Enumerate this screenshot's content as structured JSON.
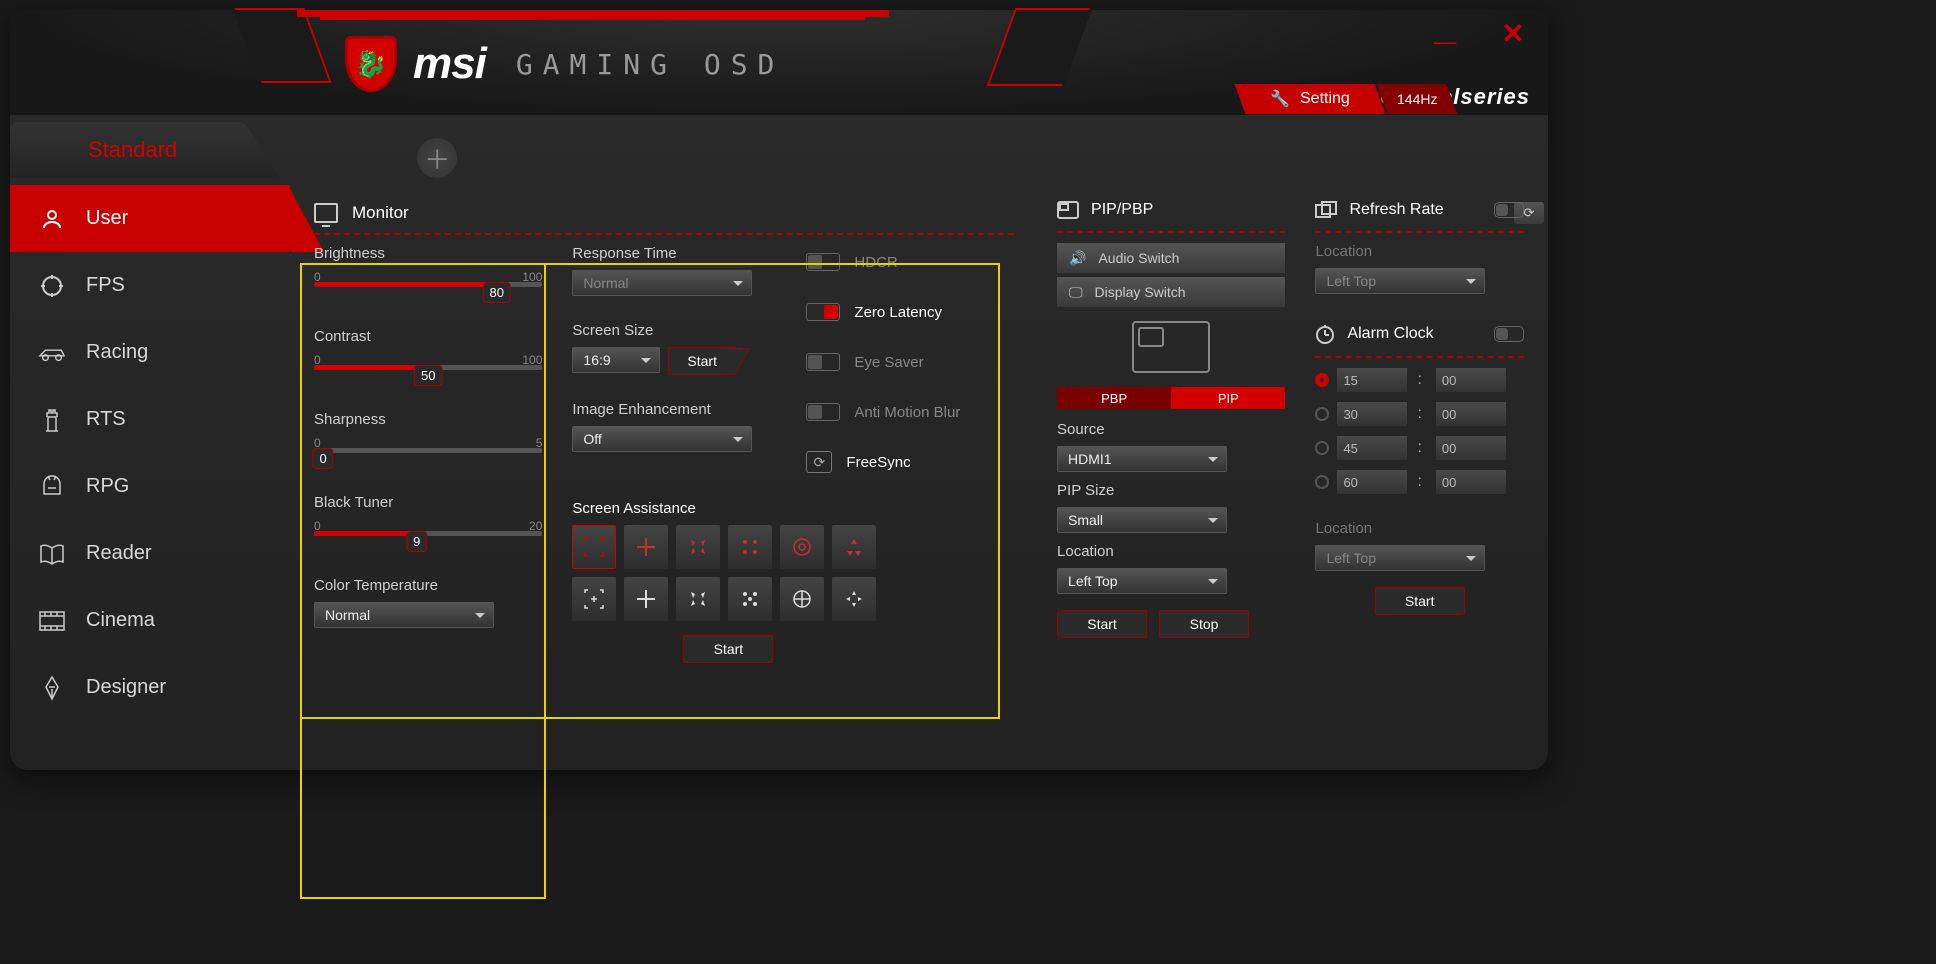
{
  "header": {
    "brand": "msi",
    "subtitle": "GAMING OSD",
    "setting_label": "Setting",
    "refresh_rate_badge": "144Hz",
    "partner_brand": "steelseries"
  },
  "profile_tab": {
    "active": "Standard"
  },
  "sidebar": {
    "items": [
      {
        "label": "User",
        "icon": "user"
      },
      {
        "label": "FPS",
        "icon": "crosshair"
      },
      {
        "label": "Racing",
        "icon": "car"
      },
      {
        "label": "RTS",
        "icon": "chess"
      },
      {
        "label": "RPG",
        "icon": "helmet"
      },
      {
        "label": "Reader",
        "icon": "book"
      },
      {
        "label": "Cinema",
        "icon": "film"
      },
      {
        "label": "Designer",
        "icon": "pen"
      }
    ],
    "active_index": 0
  },
  "monitor": {
    "title": "Monitor",
    "brightness": {
      "label": "Brightness",
      "min": "0",
      "max": "100",
      "value": "80",
      "percent": 80
    },
    "contrast": {
      "label": "Contrast",
      "min": "0",
      "max": "100",
      "value": "50",
      "percent": 50
    },
    "sharpness": {
      "label": "Sharpness",
      "min": "0",
      "max": "5",
      "value": "0",
      "percent": 0
    },
    "black_tuner": {
      "label": "Black Tuner",
      "min": "0",
      "max": "20",
      "value": "9",
      "percent": 45
    },
    "color_temp": {
      "label": "Color Temperature",
      "value": "Normal"
    },
    "response_time": {
      "label": "Response Time",
      "value": "Normal"
    },
    "screen_size": {
      "label": "Screen Size",
      "value": "16:9",
      "button": "Start"
    },
    "image_enh": {
      "label": "Image Enhancement",
      "value": "Off"
    },
    "toggles": {
      "hdcr": {
        "label": "HDCR",
        "on": false
      },
      "zero_latency": {
        "label": "Zero Latency",
        "on": true
      },
      "eye_saver": {
        "label": "Eye Saver",
        "on": false
      },
      "anti_motion_blur": {
        "label": "Anti Motion Blur",
        "on": false
      },
      "freesync": {
        "label": "FreeSync"
      }
    },
    "screen_assist": {
      "label": "Screen Assistance",
      "start": "Start"
    }
  },
  "pip": {
    "title": "PIP/PBP",
    "audio_switch": "Audio Switch",
    "display_switch": "Display Switch",
    "pbp": "PBP",
    "pip": "PIP",
    "source_label": "Source",
    "source_value": "HDMI1",
    "size_label": "PIP Size",
    "size_value": "Small",
    "location_label": "Location",
    "location_value": "Left Top",
    "start": "Start",
    "stop": "Stop"
  },
  "refresh": {
    "title": "Refresh Rate",
    "location_label": "Location",
    "location_value": "Left Top"
  },
  "alarm": {
    "title": "Alarm Clock",
    "rows": [
      {
        "min": "15",
        "sec": "00",
        "selected": true
      },
      {
        "min": "30",
        "sec": "00",
        "selected": false
      },
      {
        "min": "45",
        "sec": "00",
        "selected": false
      },
      {
        "min": "60",
        "sec": "00",
        "selected": false
      }
    ],
    "location_label": "Location",
    "location_value": "Left Top",
    "start": "Start"
  }
}
